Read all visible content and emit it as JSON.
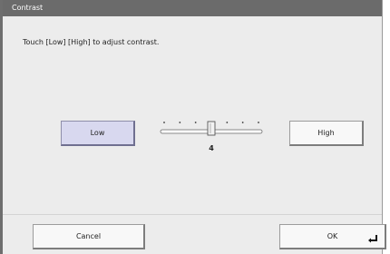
{
  "dialog": {
    "title": "Contrast",
    "instruction": "Touch [Low] [High] to adjust contrast."
  },
  "contrast": {
    "low_label": "Low",
    "high_label": "High",
    "value": "4",
    "min": 1,
    "max": 7,
    "level": 4,
    "tick_count": 7
  },
  "footer": {
    "cancel_label": "Cancel",
    "ok_label": "OK"
  },
  "icons": {
    "ok": "enter-icon"
  },
  "colors": {
    "titlebar": "#6b6b6b",
    "panel": "#ececec",
    "low_button": "#d8d8ef"
  }
}
